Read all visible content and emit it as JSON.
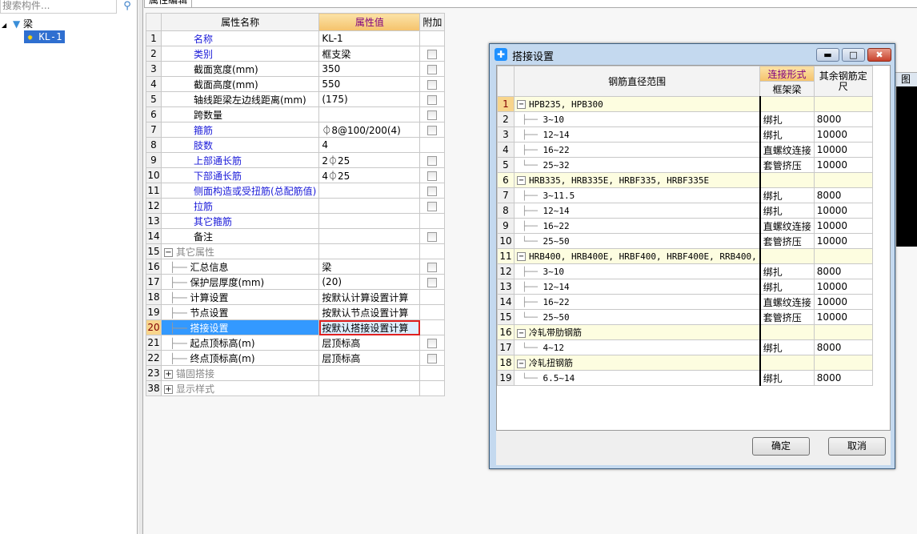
{
  "left": {
    "search_placeholder": "搜索构件...",
    "tree": {
      "root": "梁",
      "child": "KL-1"
    }
  },
  "tab": "属性编辑",
  "props": {
    "headers": [
      "属性名称",
      "属性值",
      "附加"
    ],
    "rows": [
      {
        "n": "1",
        "name": "名称",
        "value": "KL-1",
        "blue": true,
        "cb": false
      },
      {
        "n": "2",
        "name": "类别",
        "value": "框支梁",
        "blue": true,
        "cb": true
      },
      {
        "n": "3",
        "name": "截面宽度(mm)",
        "value": "350",
        "cb": true
      },
      {
        "n": "4",
        "name": "截面高度(mm)",
        "value": "550",
        "cb": true
      },
      {
        "n": "5",
        "name": "轴线距梁左边线距离(mm)",
        "value": "(175)",
        "cb": true
      },
      {
        "n": "6",
        "name": "跨数量",
        "value": "",
        "cb": true
      },
      {
        "n": "7",
        "name": "箍筋",
        "value": "⏀8@100/200(4)",
        "blue": true,
        "cb": true
      },
      {
        "n": "8",
        "name": "肢数",
        "value": "4",
        "blue": true,
        "cb": false
      },
      {
        "n": "9",
        "name": "上部通长筋",
        "value": "2⏀25",
        "blue": true,
        "cb": true
      },
      {
        "n": "10",
        "name": "下部通长筋",
        "value": "4⏀25",
        "blue": true,
        "cb": true
      },
      {
        "n": "11",
        "name": "侧面构造或受扭筋(总配筋值)",
        "value": "",
        "blue": true,
        "cb": true
      },
      {
        "n": "12",
        "name": "拉筋",
        "value": "",
        "blue": true,
        "cb": true
      },
      {
        "n": "13",
        "name": "其它箍筋",
        "value": "",
        "blue": true,
        "cb": false
      },
      {
        "n": "14",
        "name": "备注",
        "value": "",
        "cb": true
      },
      {
        "n": "15",
        "name": "其它属性",
        "value": "",
        "group": "-",
        "cb": false
      },
      {
        "n": "16",
        "name": "汇总信息",
        "value": "梁",
        "child": true,
        "cb": true
      },
      {
        "n": "17",
        "name": "保护层厚度(mm)",
        "value": "(20)",
        "child": true,
        "cb": true
      },
      {
        "n": "18",
        "name": "计算设置",
        "value": "按默认计算设置计算",
        "child": true,
        "cb": false
      },
      {
        "n": "19",
        "name": "节点设置",
        "value": "按默认节点设置计算",
        "child": true,
        "cb": false
      },
      {
        "n": "20",
        "name": "搭接设置",
        "value": "按默认搭接设置计算",
        "child": true,
        "selected": true,
        "cb": false
      },
      {
        "n": "21",
        "name": "起点顶标高(m)",
        "value": "层顶标高",
        "child": true,
        "cb": true
      },
      {
        "n": "22",
        "name": "终点顶标高(m)",
        "value": "层顶标高",
        "child": true,
        "cb": true
      },
      {
        "n": "23",
        "name": "锚固搭接",
        "value": "",
        "group": "+",
        "cb": false
      },
      {
        "n": "38",
        "name": "显示样式",
        "value": "",
        "group": "+",
        "cb": false
      }
    ]
  },
  "dialog": {
    "title": "搭接设置",
    "headers": {
      "range": "钢筋直径范围",
      "conn": "连接形式",
      "conn_sub": "框架梁",
      "length": "其余钢筋定尺"
    },
    "rows": [
      {
        "n": "1",
        "range": "HPB235, HPB300",
        "group": true
      },
      {
        "n": "2",
        "range": "3~10",
        "type": "绑扎",
        "len": "8000"
      },
      {
        "n": "3",
        "range": "12~14",
        "type": "绑扎",
        "len": "10000"
      },
      {
        "n": "4",
        "range": "16~22",
        "type": "直螺纹连接",
        "len": "10000"
      },
      {
        "n": "5",
        "range": "25~32",
        "type": "套管挤压",
        "len": "10000",
        "last": true
      },
      {
        "n": "6",
        "range": "HRB335, HRB335E, HRBF335, HRBF335E",
        "group": true
      },
      {
        "n": "7",
        "range": "3~11.5",
        "type": "绑扎",
        "len": "8000"
      },
      {
        "n": "8",
        "range": "12~14",
        "type": "绑扎",
        "len": "10000"
      },
      {
        "n": "9",
        "range": "16~22",
        "type": "直螺纹连接",
        "len": "10000"
      },
      {
        "n": "10",
        "range": "25~50",
        "type": "套管挤压",
        "len": "10000",
        "last": true
      },
      {
        "n": "11",
        "range": "HRB400, HRB400E, HRBF400, HRBF400E, RRB400,",
        "group": true
      },
      {
        "n": "12",
        "range": "3~10",
        "type": "绑扎",
        "len": "8000"
      },
      {
        "n": "13",
        "range": "12~14",
        "type": "绑扎",
        "len": "10000"
      },
      {
        "n": "14",
        "range": "16~22",
        "type": "直螺纹连接",
        "len": "10000"
      },
      {
        "n": "15",
        "range": "25~50",
        "type": "套管挤压",
        "len": "10000",
        "last": true
      },
      {
        "n": "16",
        "range": "冷轧带肋钢筋",
        "group": true
      },
      {
        "n": "17",
        "range": "4~12",
        "type": "绑扎",
        "len": "8000",
        "last": true
      },
      {
        "n": "18",
        "range": "冷轧扭钢筋",
        "group": true
      },
      {
        "n": "19",
        "range": "6.5~14",
        "type": "绑扎",
        "len": "8000",
        "last": true
      }
    ],
    "ok": "确定",
    "cancel": "取消"
  },
  "background_window_label": "图",
  "colors": {
    "selected": "#3399ff",
    "header_accent": "#f5c26b",
    "highlight_box": "#e02020"
  }
}
